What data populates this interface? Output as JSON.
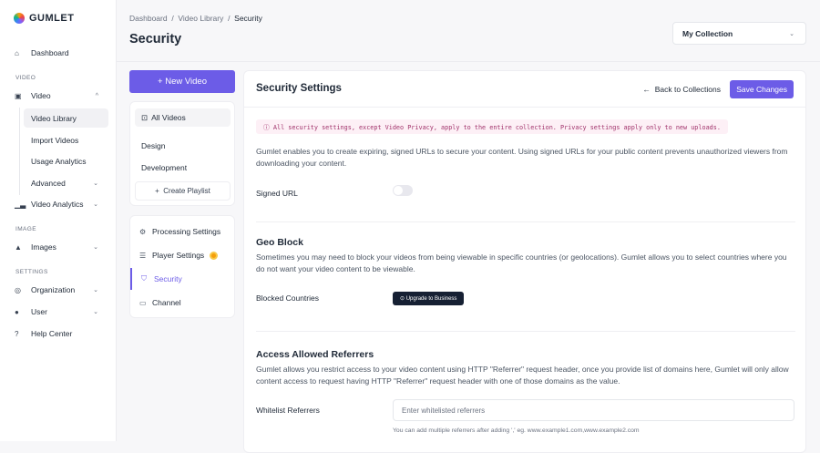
{
  "brand": "GUMLET",
  "sidebar": {
    "dashboard": "Dashboard",
    "sections": [
      "VIDEO",
      "IMAGE",
      "SETTINGS"
    ],
    "video": "Video",
    "video_sub": [
      "Video Library",
      "Import Videos",
      "Usage Analytics",
      "Advanced"
    ],
    "video_analytics": "Video Analytics",
    "images": "Images",
    "organization": "Organization",
    "user": "User",
    "help": "Help Center"
  },
  "breadcrumb": [
    "Dashboard",
    "Video Library",
    "Security"
  ],
  "page_title": "Security",
  "collection": "My Collection",
  "new_video": "New Video",
  "playlists": {
    "all": "All Videos",
    "items": [
      "Design",
      "Development"
    ],
    "create": "Create Playlist"
  },
  "settings_tabs": [
    "Processing Settings",
    "Player Settings",
    "Security",
    "Channel"
  ],
  "main": {
    "title": "Security Settings",
    "back": "Back to Collections",
    "save": "Save Changes",
    "note": "All security settings, except Video Privacy, apply to the entire collection. Privacy settings apply only to new uploads.",
    "signed_desc": "Gumlet enables you to create expiring, signed URLs to secure your content. Using signed URLs for your public content prevents unauthorized viewers from downloading your content.",
    "signed_label": "Signed URL",
    "signed_enabled": false,
    "geo_title": "Geo Block",
    "geo_desc": "Sometimes you may need to block your videos from being viewable in specific countries (or geolocations). Gumlet allows you to select countries where you do not want your video content to be viewable.",
    "blocked_label": "Blocked Countries",
    "upgrade": "Upgrade to Business",
    "ref_title": "Access Allowed Referrers",
    "ref_desc": "Gumlet allows you restrict access to your video content using HTTP \"Referrer\" request header, once you provide list of domains here, Gumlet will only allow content access to request having HTTP \"Referrer\" request header with one of those domains as the value.",
    "whitelist_label": "Whitelist Referrers",
    "whitelist_placeholder": "Enter whitelisted referrers",
    "hint": "You can add multiple referrers after adding ',' eg. www.example1.com,www.example2.com"
  }
}
